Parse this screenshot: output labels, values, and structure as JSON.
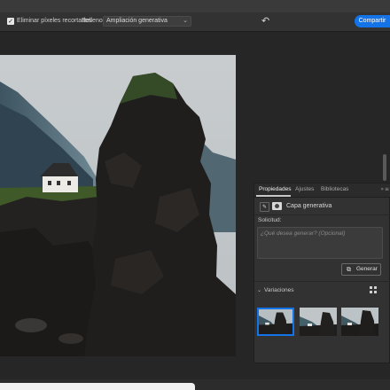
{
  "options_bar": {
    "remove_cropped_pixels_checked": true,
    "remove_cropped_pixels_label": "Eliminar píxeles recortados",
    "fill_label": "Relleno:",
    "fill_value": "Ampliación generativa",
    "share_label": "Compartir"
  },
  "properties_panel": {
    "tabs": [
      "Propiedades",
      "Ajustes",
      "Bibliotecas"
    ],
    "active_tab": "Propiedades",
    "layer_name": "Capa generativa",
    "prompt_label": "Solicitud:",
    "prompt_placeholder": "¿Qué desea generar? (Opcional)",
    "generate_label": "Generar",
    "variations_label": "Variaciones",
    "selected_variation": 1
  },
  "colors": {
    "accent": "#1473e6",
    "panel_bg": "#323232",
    "app_bg": "#282828"
  },
  "icons": {
    "checkbox": "check-icon",
    "undo": "undo-icon",
    "layer_type": "generative-layer-icon",
    "mask": "mask-icon",
    "generate": "generate-icon",
    "grid_view": "grid-icon",
    "collapse": "collapse-icon",
    "menu": "menu-icon"
  }
}
